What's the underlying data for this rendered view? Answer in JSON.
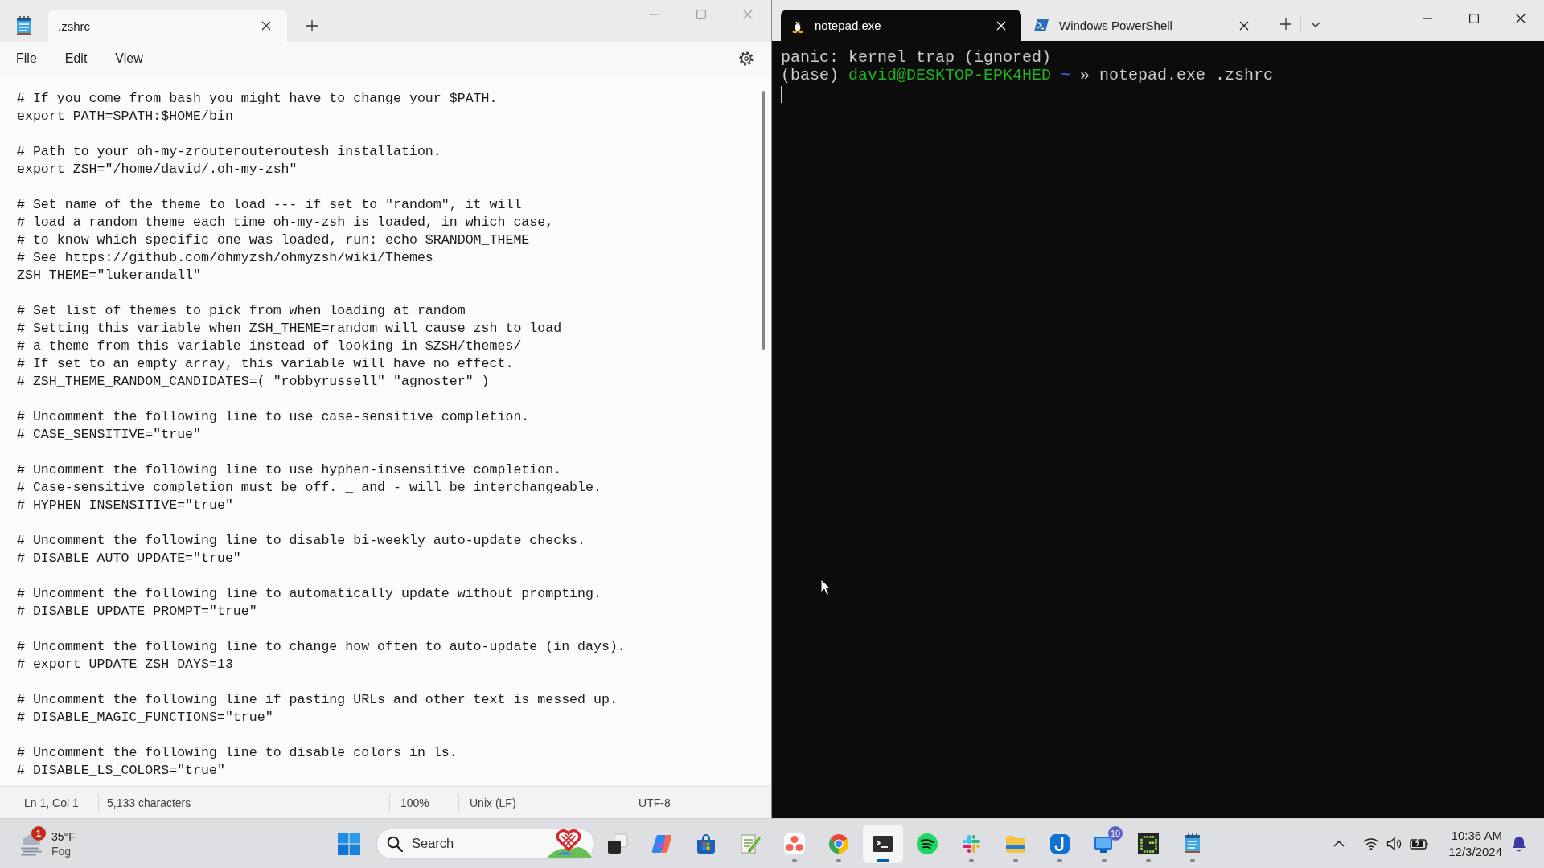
{
  "notepad": {
    "tabs": [
      {
        "title": ".zshrc",
        "selected": true
      }
    ],
    "menu": [
      {
        "label": "File"
      },
      {
        "label": "Edit"
      },
      {
        "label": "View"
      }
    ],
    "blocks": [
      [
        "# If you come from bash you might have to change your $PATH.",
        "export PATH=$PATH:$HOME/bin"
      ],
      [
        "# Path to your oh-my-zrouterouteroutesh installation.",
        "export ZSH=\"/home/david/.oh-my-zsh\""
      ],
      [
        "# Set name of the theme to load --- if set to \"random\", it will",
        "# load a random theme each time oh-my-zsh is loaded, in which case,",
        "# to know which specific one was loaded, run: echo $RANDOM_THEME",
        "# See https://github.com/ohmyzsh/ohmyzsh/wiki/Themes",
        "ZSH_THEME=\"lukerandall\""
      ],
      [
        "# Set list of themes to pick from when loading at random",
        "# Setting this variable when ZSH_THEME=random will cause zsh to load",
        "# a theme from this variable instead of looking in $ZSH/themes/",
        "# If set to an empty array, this variable will have no effect.",
        "# ZSH_THEME_RANDOM_CANDIDATES=( \"robbyrussell\" \"agnoster\" )"
      ],
      [
        "# Uncomment the following line to use case-sensitive completion.",
        "# CASE_SENSITIVE=\"true\""
      ],
      [
        "# Uncomment the following line to use hyphen-insensitive completion.",
        "# Case-sensitive completion must be off. _ and - will be interchangeable.",
        "# HYPHEN_INSENSITIVE=\"true\""
      ],
      [
        "# Uncomment the following line to disable bi-weekly auto-update checks.",
        "# DISABLE_AUTO_UPDATE=\"true\""
      ],
      [
        "# Uncomment the following line to automatically update without prompting.",
        "# DISABLE_UPDATE_PROMPT=\"true\""
      ],
      [
        "# Uncomment the following line to change how often to auto-update (in days).",
        "# export UPDATE_ZSH_DAYS=13"
      ],
      [
        "# Uncomment the following line if pasting URLs and other text is messed up.",
        "# DISABLE_MAGIC_FUNCTIONS=\"true\""
      ],
      [
        "# Uncomment the following line to disable colors in ls.",
        "# DISABLE_LS_COLORS=\"true\""
      ]
    ],
    "status_bar": {
      "position": "Ln 1, Col 1",
      "characters": "5,133 characters",
      "zoom": "100%",
      "line_ending": "Unix (LF)",
      "encoding": "UTF-8"
    }
  },
  "terminal": {
    "tabs": [
      {
        "title": "notepad.exe",
        "kind": "penguin",
        "selected": true
      },
      {
        "title": "Windows PowerShell",
        "kind": "shell",
        "selected": false
      }
    ],
    "lines": [
      [
        {
          "kind": "output",
          "text": "panic: kernel trap (ignored)"
        }
      ],
      [
        {
          "kind": "output",
          "text": "(base)"
        },
        {
          "kind": "user",
          "text": "david@DESKTOP-EPK4HED"
        },
        {
          "kind": "path",
          "text": "~"
        },
        {
          "kind": "output",
          "text": "» notepad.exe .zshrc"
        }
      ]
    ]
  },
  "taskbar": {
    "weather": {
      "badge": "1",
      "temperature": "35°F",
      "condition": "Fog"
    },
    "search": {
      "placeholder": "Search"
    },
    "apps": [
      {
        "kind": "taskview",
        "running": false,
        "active": false
      },
      {
        "kind": "swirl",
        "running": false,
        "active": false
      },
      {
        "kind": "bag",
        "running": false,
        "active": false
      },
      {
        "kind": "padpen",
        "running": false,
        "active": false
      },
      {
        "kind": "dots",
        "running": true,
        "active": false
      },
      {
        "kind": "ring",
        "running": true,
        "active": false
      },
      {
        "kind": "terminal",
        "running": true,
        "active": true
      },
      {
        "kind": "waves",
        "running": false,
        "active": false
      },
      {
        "kind": "pinwheel",
        "running": true,
        "active": false
      },
      {
        "kind": "folder",
        "running": true,
        "active": false
      },
      {
        "kind": "hook",
        "running": true,
        "active": false
      },
      {
        "kind": "monitor",
        "running": true,
        "active": false,
        "badge": "10"
      },
      {
        "kind": "grid",
        "running": true,
        "active": false
      },
      {
        "kind": "notepad",
        "running": true,
        "active": false
      }
    ],
    "clock": {
      "time": "10:36 AM",
      "date": "12/3/2024"
    }
  }
}
